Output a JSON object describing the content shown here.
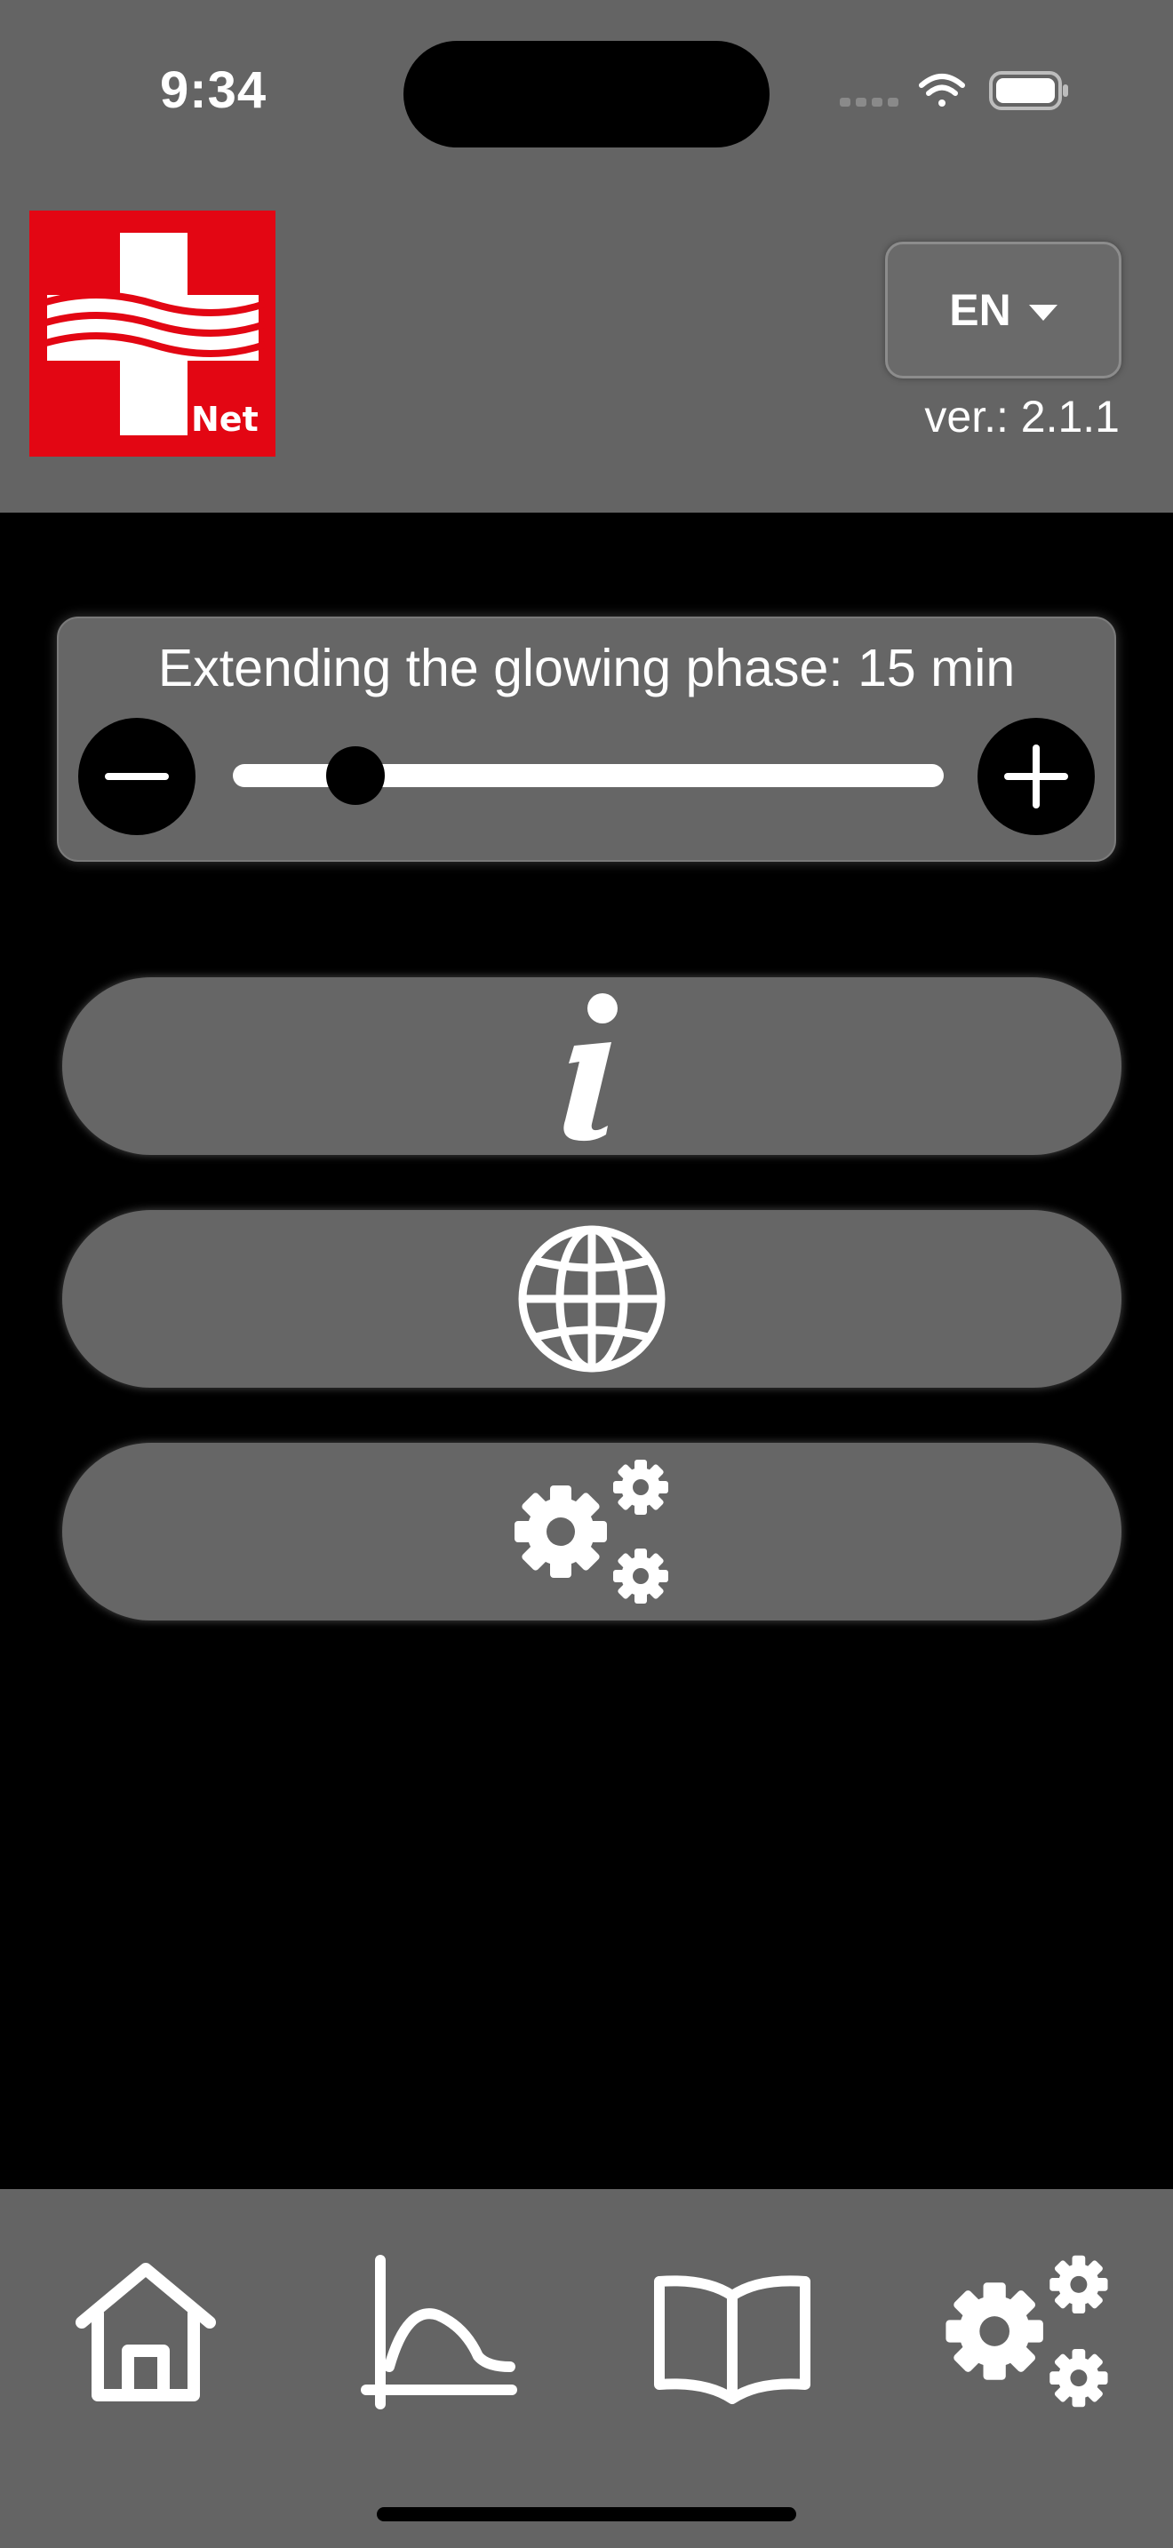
{
  "status_bar": {
    "time": "9:34",
    "icons": [
      "signal-dots-icon",
      "wifi-icon",
      "battery-icon"
    ]
  },
  "header": {
    "logo_text": "Net",
    "language": "EN",
    "version": "ver.: 2.1.1"
  },
  "glow_control": {
    "label": "Extending the glowing phase: 15 min",
    "slider_fraction": 0.16,
    "decrease_icon": "minus-icon",
    "increase_icon": "plus-icon"
  },
  "menu": [
    {
      "icon": "info-icon"
    },
    {
      "icon": "globe-icon"
    },
    {
      "icon": "gears-icon"
    }
  ],
  "tabbar": [
    {
      "icon": "home-icon"
    },
    {
      "icon": "chart-icon"
    },
    {
      "icon": "book-icon"
    },
    {
      "icon": "settings-gears-icon"
    }
  ],
  "colors": {
    "brand_red": "#e30613",
    "panel_gray": "#646464",
    "background": "#000000"
  }
}
